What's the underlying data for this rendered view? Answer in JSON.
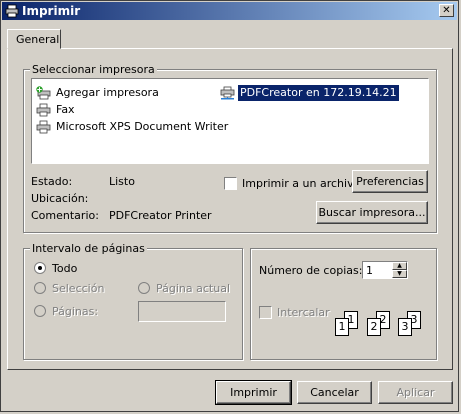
{
  "window": {
    "title": "Imprimir",
    "close_glyph": "✕"
  },
  "tabs": [
    {
      "label": "General"
    }
  ],
  "printer_group": {
    "label": "Seleccionar impresora",
    "printers": [
      {
        "name": "Agregar impresora",
        "icon": "add-printer-icon"
      },
      {
        "name": "Fax",
        "icon": "printer-icon"
      },
      {
        "name": "Microsoft XPS Document Writer",
        "icon": "printer-icon"
      },
      {
        "name": "PDFCreator en 172.19.14.21",
        "icon": "network-printer-icon",
        "selected": true
      }
    ],
    "status_label": "Estado:",
    "status_value": "Listo",
    "location_label": "Ubicación:",
    "location_value": "",
    "comment_label": "Comentario:",
    "comment_value": "PDFCreator Printer",
    "print_to_file_label": "Imprimir a un archivo",
    "preferences_button": "Preferencias",
    "find_printer_button": "Buscar impresora..."
  },
  "page_range": {
    "label": "Intervalo de páginas",
    "all": "Todo",
    "selection": "Selección",
    "current_page": "Página actual",
    "pages": "Páginas:"
  },
  "copies": {
    "label": "Número de copias:",
    "value": "1",
    "collate_label": "Intercalar",
    "collate_pages": [
      "1",
      "1",
      "2",
      "2",
      "3",
      "3"
    ]
  },
  "buttons": {
    "print": "Imprimir",
    "cancel": "Cancelar",
    "apply": "Aplicar"
  }
}
